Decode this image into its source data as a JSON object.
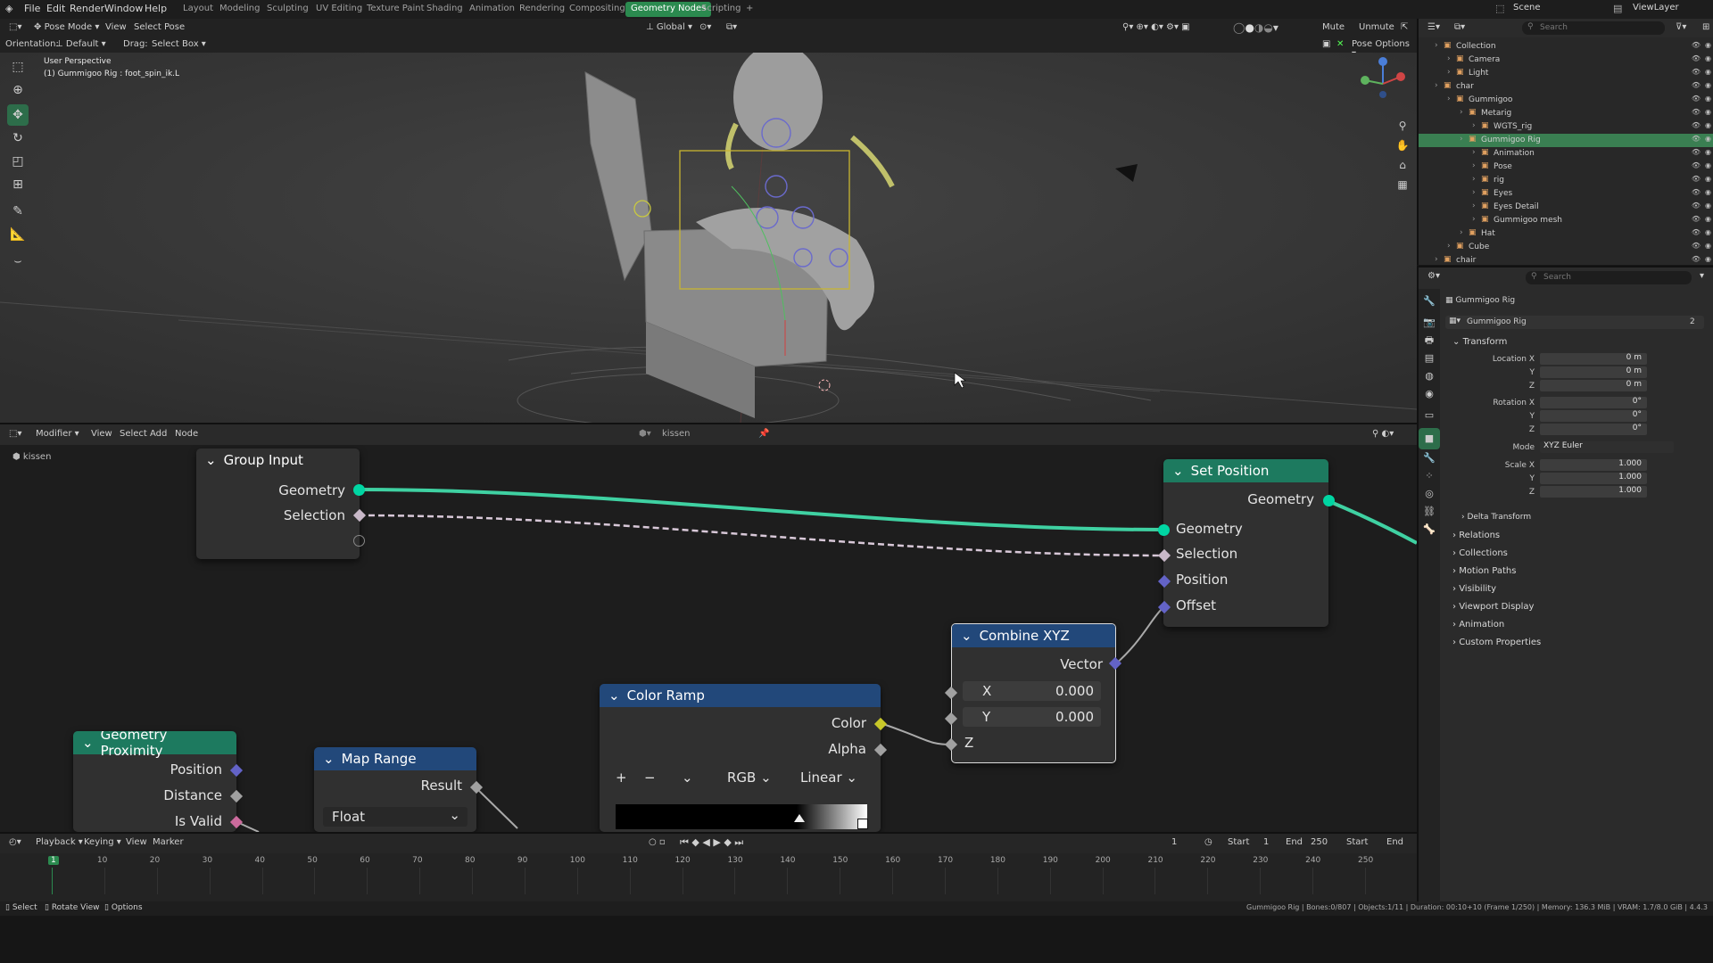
{
  "topbar": {
    "menus": [
      "File",
      "Edit",
      "Render",
      "Window",
      "Help"
    ],
    "workspaces": [
      "Layout",
      "Modeling",
      "Sculpting",
      "UV Editing",
      "Texture Paint",
      "Shading",
      "Animation",
      "Rendering",
      "Compositing",
      "Geometry Nodes",
      "Scripting"
    ],
    "active_workspace": "Geometry Nodes",
    "scene": "Scene",
    "view_layer": "ViewLayer"
  },
  "viewport_header": {
    "mode": "Pose Mode",
    "menus": [
      "View",
      "Select",
      "Pose"
    ],
    "orientation_label": "Orientation:",
    "orientation_value": "Default",
    "drag_label": "Drag:",
    "drag_value": "Select Box",
    "transform": "Global",
    "mute": "Mute",
    "unmute": "Unmute",
    "pose_options": "Pose Options"
  },
  "viewport": {
    "perspective": "User Perspective",
    "active_info": "(1) Gummigoo Rig : foot_spin_ik.L"
  },
  "node_header": {
    "editor": "Modifier",
    "menus": [
      "View",
      "Select",
      "Add",
      "Node"
    ],
    "tree_name": "kissen",
    "breadcrumb": "kissen"
  },
  "nodes": {
    "group_input": {
      "title": "Group Input",
      "out_geometry": "Geometry",
      "out_selection": "Selection"
    },
    "set_position": {
      "title": "Set Position",
      "out_geometry": "Geometry",
      "in_geometry": "Geometry",
      "in_selection": "Selection",
      "in_position": "Position",
      "in_offset": "Offset"
    },
    "combine_xyz": {
      "title": "Combine XYZ",
      "out_vector": "Vector",
      "x_label": "X",
      "x_value": "0.000",
      "y_label": "Y",
      "y_value": "0.000",
      "z_label": "Z"
    },
    "color_ramp": {
      "title": "Color Ramp",
      "out_color": "Color",
      "out_alpha": "Alpha",
      "mode": "RGB",
      "interp": "Linear"
    },
    "geometry_proximity": {
      "title": "Geometry Proximity",
      "out_position": "Position",
      "out_distance": "Distance",
      "out_is_valid": "Is Valid"
    },
    "map_range": {
      "title": "Map Range",
      "out_result": "Result",
      "data_type": "Float"
    }
  },
  "timeline": {
    "menus": [
      "Playback",
      "Keying",
      "View",
      "Marker"
    ],
    "current_frame": "1",
    "start_label": "Start",
    "start_value": "1",
    "end_label": "End",
    "end_value": "250",
    "start2": "Start",
    "end2": "End",
    "ticks": [
      "1",
      "10",
      "20",
      "30",
      "40",
      "50",
      "60",
      "70",
      "80",
      "90",
      "100",
      "110",
      "120",
      "130",
      "140",
      "150",
      "160",
      "170",
      "180",
      "190",
      "200",
      "210",
      "220",
      "230",
      "240",
      "250"
    ]
  },
  "statusbar": {
    "select": "Select",
    "rotate": "Rotate View",
    "options": "Options",
    "info": "Gummigoo Rig | Bones:0/807 | Objects:1/11 | Duration: 00:10+10 (Frame 1/250) | Memory: 136.3 MiB | VRAM: 1.7/8.0 GiB | 4.4.3"
  },
  "outliner": {
    "search_placeholder": "Search",
    "rows": [
      {
        "label": "Collection",
        "indent": 0
      },
      {
        "label": "Camera",
        "indent": 1
      },
      {
        "label": "Light",
        "indent": 1
      },
      {
        "label": "char",
        "indent": 0
      },
      {
        "label": "Gummigoo",
        "indent": 1
      },
      {
        "label": "Metarig",
        "indent": 2
      },
      {
        "label": "WGTS_rig",
        "indent": 3
      },
      {
        "label": "Gummigoo Rig",
        "indent": 2
      },
      {
        "label": "Animation",
        "indent": 3
      },
      {
        "label": "Pose",
        "indent": 3
      },
      {
        "label": "rig",
        "indent": 3
      },
      {
        "label": "Eyes",
        "indent": 3
      },
      {
        "label": "Eyes Detail",
        "indent": 3
      },
      {
        "label": "Gummigoo mesh",
        "indent": 3
      },
      {
        "label": "Hat",
        "indent": 2
      },
      {
        "label": "Cube",
        "indent": 1
      },
      {
        "label": "chair",
        "indent": 0
      }
    ],
    "selected_label": "Gummigoo Rig"
  },
  "properties": {
    "search_placeholder": "Search",
    "object_name": "Gummigoo Rig",
    "data_name": "Gummigoo Rig",
    "users": "2",
    "transform_title": "Transform",
    "location_x_label": "Location X",
    "location_x": "0 m",
    "location_y_label": "Y",
    "location_y": "0 m",
    "location_z_label": "Z",
    "location_z": "0 m",
    "rotation_x_label": "Rotation X",
    "rotation_x": "0°",
    "rotation_y_label": "Y",
    "rotation_y": "0°",
    "rotation_z_label": "Z",
    "rotation_z": "0°",
    "mode_label": "Mode",
    "mode_value": "XYZ Euler",
    "scale_x_label": "Scale X",
    "scale_x": "1.000",
    "scale_y_label": "Y",
    "scale_y": "1.000",
    "scale_z_label": "Z",
    "scale_z": "1.000",
    "delta_transform": "Delta Transform",
    "panels": [
      "Relations",
      "Collections",
      "Motion Paths",
      "Visibility",
      "Viewport Display",
      "Animation",
      "Custom Properties"
    ]
  },
  "colors": {
    "geometry_socket": "#00d6a3",
    "vector_socket": "#6363c7",
    "float_socket": "#a1a1a1",
    "color_socket": "#c7c729",
    "geometry_node_header": "#1d7a5f",
    "converter_header": "#22487a",
    "active_green": "#2b8a4f"
  }
}
